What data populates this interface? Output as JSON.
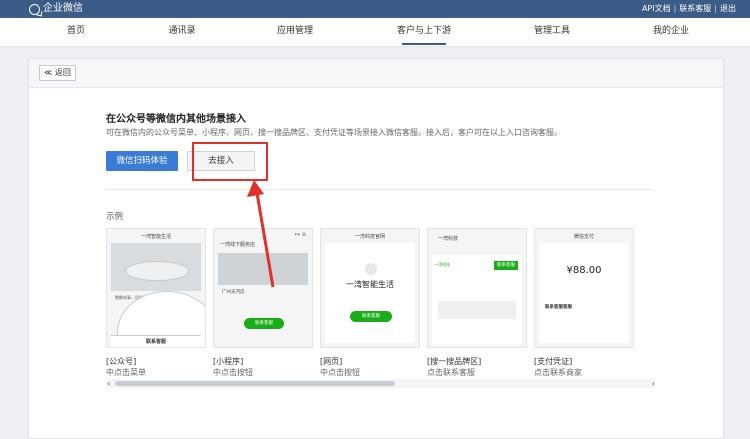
{
  "topbar": {
    "logo_text": "企业微信",
    "links": [
      "API文档",
      "联系客服",
      "退出"
    ]
  },
  "nav": {
    "items": [
      "首页",
      "通讯录",
      "应用管理",
      "客户与上下游",
      "管理工具",
      "我的企业"
    ],
    "active_index": 3
  },
  "subbar": {
    "back_label": "≪ 返回"
  },
  "main": {
    "title": "在公众号等微信内其他场景接入",
    "description": "可在微信内的公众号菜单、小程序、网页、搜一搜品牌区、支付凭证等场景接入微信客服。接入后，客户可在以上入口咨询客服。",
    "primary_button": "微信扫码体验",
    "secondary_button": "去接入",
    "example_label": "示例"
  },
  "examples": [
    {
      "title": "一湾智能生活",
      "line1": "[公众号]",
      "line2": "中点击菜单",
      "inner_text": "联系客服",
      "sub_text": "鹏鹏有事，用科技温暖生活"
    },
    {
      "title": "一湾线下服务店",
      "line1": "[小程序]",
      "line2": "中点击按钮",
      "inner_text": "联系客服",
      "sub_text": "广州天河店"
    },
    {
      "title": "一湾科技官网",
      "line1": "[网页]",
      "line2": "中点击按钮",
      "inner_text": "联系客服",
      "sub_text": "一湾智能生活"
    },
    {
      "title": "一湾科技",
      "line1": "[搜一搜品牌区]",
      "line2": "点击联系客服",
      "inner_text": "联系客服",
      "sub_text": "一湾科技"
    },
    {
      "title": "微信支付",
      "line1": "[支付凭证]",
      "line2": "点击联系商家",
      "inner_text": "联系客服客服",
      "sub_text": "¥88.00"
    }
  ],
  "colors": {
    "topbar": "#3b5c86",
    "primary": "#3a7bd5",
    "highlight": "#e0302a",
    "green": "#1aad19"
  }
}
